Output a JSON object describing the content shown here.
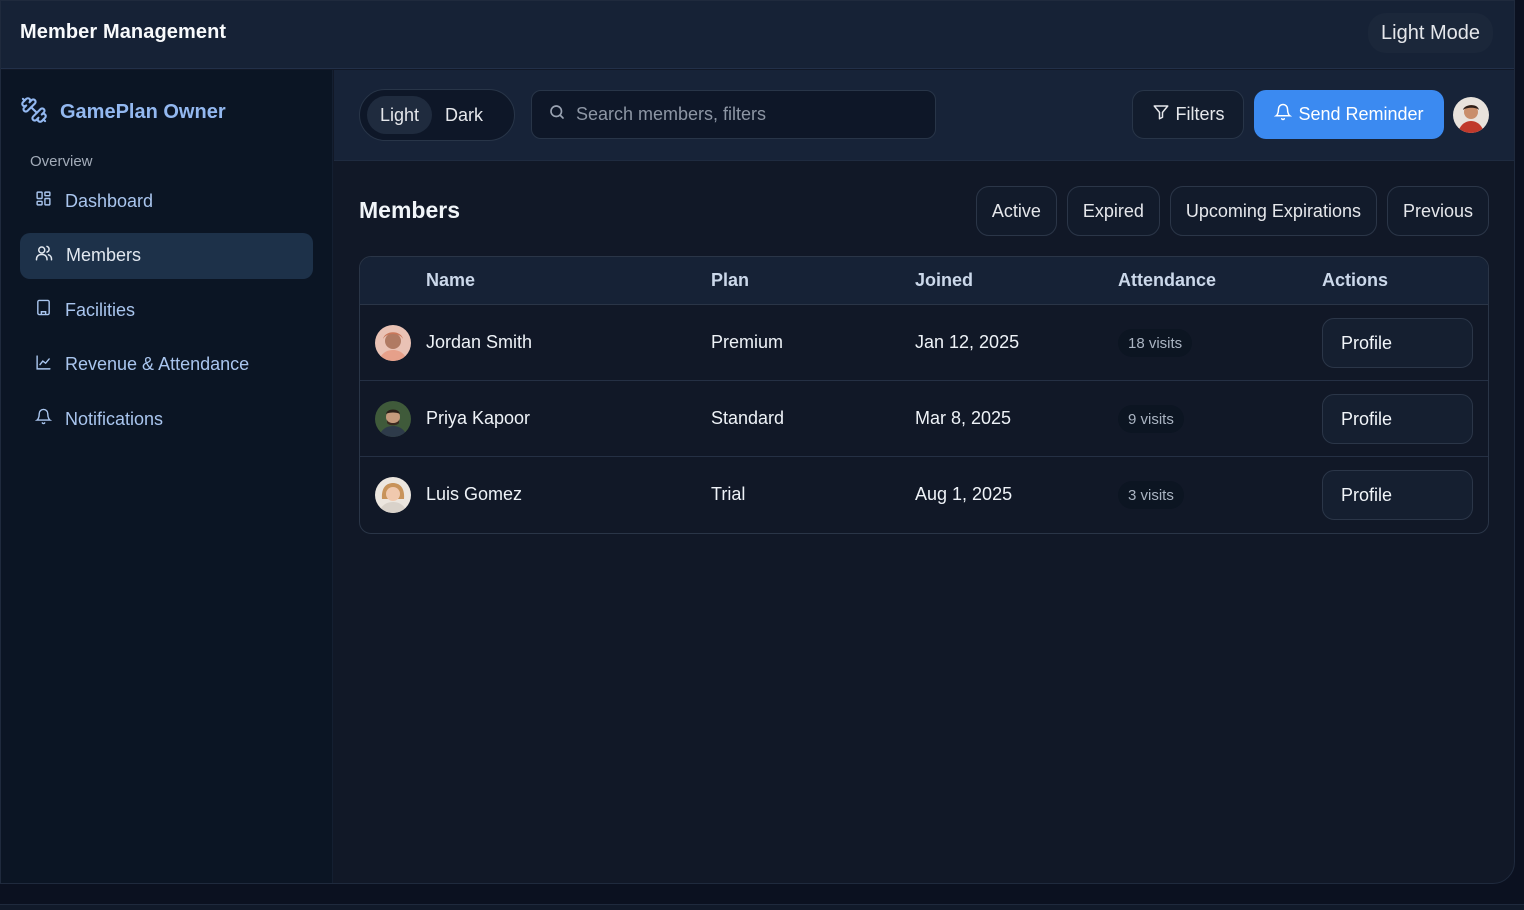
{
  "window": {
    "title": "Member Management",
    "mode_toggle": "Light Mode"
  },
  "sidebar": {
    "brand": "GamePlan Owner",
    "section": "Overview",
    "items": [
      {
        "label": "Dashboard",
        "icon": "dashboard-icon"
      },
      {
        "label": "Members",
        "icon": "users-icon",
        "active": true
      },
      {
        "label": "Facilities",
        "icon": "building-icon"
      },
      {
        "label": "Revenue & Attendance",
        "icon": "chart-icon"
      },
      {
        "label": "Notifications",
        "icon": "bell-icon"
      }
    ]
  },
  "topbar": {
    "theme": {
      "light": "Light",
      "dark": "Dark",
      "selected": "Light"
    },
    "search_placeholder": "Search members, filters",
    "filters_label": "Filters",
    "reminder_label": "Send Reminder"
  },
  "members": {
    "title": "Members",
    "filters": [
      "Active",
      "Expired",
      "Upcoming Expirations",
      "Previous"
    ],
    "columns": [
      "Name",
      "Plan",
      "Joined",
      "Attendance",
      "Actions"
    ],
    "rows": [
      {
        "name": "Jordan Smith",
        "plan": "Premium",
        "joined": "Jan 12, 2025",
        "attendance": "18 visits",
        "action": "Profile"
      },
      {
        "name": "Priya Kapoor",
        "plan": "Standard",
        "joined": "Mar 8, 2025",
        "attendance": "9 visits",
        "action": "Profile"
      },
      {
        "name": "Luis Gomez",
        "plan": "Trial",
        "joined": "Aug 1, 2025",
        "attendance": "3 visits",
        "action": "Profile"
      }
    ]
  },
  "colors": {
    "accent": "#3b8af1",
    "background": "#111827",
    "sidebar": "#0b1524"
  }
}
